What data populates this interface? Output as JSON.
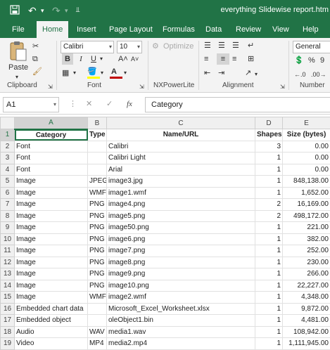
{
  "titlebar": {
    "doc_title": "everything Slidewise report.htm",
    "save_icon": "save-icon",
    "undo": "↶",
    "redo": "↷",
    "customize": "⫫"
  },
  "tabs": [
    "File",
    "Home",
    "Insert",
    "Page Layout",
    "Formulas",
    "Data",
    "Review",
    "View",
    "Help"
  ],
  "active_tab": "Home",
  "ribbon": {
    "clipboard": {
      "paste_label": "Paste",
      "group_label": "Clipboard"
    },
    "font": {
      "font_name": "Calibri",
      "font_size": "10",
      "bold": "B",
      "italic": "I",
      "underline": "U",
      "grow": "A˄",
      "shrink": "A˅",
      "group_label": "Font"
    },
    "nxpowerlite": {
      "optimize_label": "Optimize",
      "group_label": "NXPowerLite"
    },
    "alignment": {
      "group_label": "Alignment"
    },
    "number": {
      "format": "General",
      "percent": "%",
      "comma": "9",
      "group_label": "Number"
    }
  },
  "formula_bar": {
    "name_box": "A1",
    "cancel": "✕",
    "enter": "✓",
    "fx": "fx",
    "value": "Category"
  },
  "grid": {
    "columns": [
      "A",
      "B",
      "C",
      "D",
      "E"
    ],
    "header": {
      "category": "Category",
      "type": "Type",
      "name": "Name/URL",
      "shapes": "Shapes",
      "size": "Size (bytes)"
    },
    "rows": [
      {
        "n": "1"
      },
      {
        "n": "2",
        "category": "Font",
        "type": "",
        "name": "Calibri",
        "shapes": "3",
        "size": "0.00"
      },
      {
        "n": "3",
        "category": "Font",
        "type": "",
        "name": "Calibri Light",
        "shapes": "1",
        "size": "0.00"
      },
      {
        "n": "4",
        "category": "Font",
        "type": "",
        "name": "Arial",
        "shapes": "1",
        "size": "0.00"
      },
      {
        "n": "5",
        "category": "Image",
        "type": "JPEG",
        "name": "image3.jpg",
        "shapes": "1",
        "size": "848,138.00"
      },
      {
        "n": "6",
        "category": "Image",
        "type": "WMF",
        "name": "image1.wmf",
        "shapes": "1",
        "size": "1,652.00"
      },
      {
        "n": "7",
        "category": "Image",
        "type": "PNG",
        "name": "image4.png",
        "shapes": "2",
        "size": "16,169.00"
      },
      {
        "n": "8",
        "category": "Image",
        "type": "PNG",
        "name": "image5.png",
        "shapes": "2",
        "size": "498,172.00"
      },
      {
        "n": "9",
        "category": "Image",
        "type": "PNG",
        "name": "image50.png",
        "shapes": "1",
        "size": "221.00"
      },
      {
        "n": "10",
        "category": "Image",
        "type": "PNG",
        "name": "image6.png",
        "shapes": "1",
        "size": "382.00"
      },
      {
        "n": "11",
        "category": "Image",
        "type": "PNG",
        "name": "image7.png",
        "shapes": "1",
        "size": "252.00"
      },
      {
        "n": "12",
        "category": "Image",
        "type": "PNG",
        "name": "image8.png",
        "shapes": "1",
        "size": "230.00"
      },
      {
        "n": "13",
        "category": "Image",
        "type": "PNG",
        "name": "image9.png",
        "shapes": "1",
        "size": "266.00"
      },
      {
        "n": "14",
        "category": "Image",
        "type": "PNG",
        "name": "image10.png",
        "shapes": "1",
        "size": "22,227.00"
      },
      {
        "n": "15",
        "category": "Image",
        "type": "WMF",
        "name": "image2.wmf",
        "shapes": "1",
        "size": "4,348.00"
      },
      {
        "n": "16",
        "category": "Embedded chart data",
        "type": "",
        "name": "Microsoft_Excel_Worksheet.xlsx",
        "shapes": "1",
        "size": "9,872.00"
      },
      {
        "n": "17",
        "category": "Embedded object",
        "type": "",
        "name": "oleObject1.bin",
        "shapes": "1",
        "size": "4,481.00"
      },
      {
        "n": "18",
        "category": "Audio",
        "type": "WAV",
        "name": "media1.wav",
        "shapes": "1",
        "size": "108,942.00"
      },
      {
        "n": "19",
        "category": "Video",
        "type": "MP4",
        "name": "media2.mp4",
        "shapes": "1",
        "size": "1,111,945.00"
      }
    ]
  },
  "colors": {
    "brand": "#217346",
    "ribbon_bg": "#f3f3f3",
    "font_red": "#c00000",
    "highlight_yellow": "#ffff00"
  }
}
